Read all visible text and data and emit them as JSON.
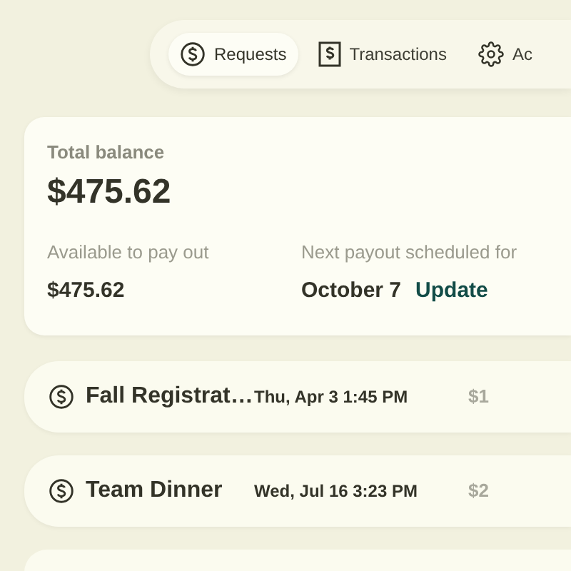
{
  "tabs": [
    {
      "label": "Requests",
      "kind": "dollar",
      "selected": true
    },
    {
      "label": "Transactions",
      "kind": "receipt",
      "selected": false
    },
    {
      "label": "Ac",
      "kind": "gear",
      "selected": false
    }
  ],
  "balance": {
    "label": "Total balance",
    "amount": "$475.62",
    "available_label": "Available to pay out",
    "available_amount": "$475.62",
    "payout_label": "Next payout scheduled for",
    "payout_date": "October 7",
    "update_link": "Update"
  },
  "requests": [
    {
      "title": "Fall Registrat…",
      "date": "Thu, Apr 3 1:45 PM",
      "amount": "$1"
    },
    {
      "title": "Team Dinner",
      "date": "Wed, Jul 16 3:23 PM",
      "amount": "$2"
    }
  ]
}
